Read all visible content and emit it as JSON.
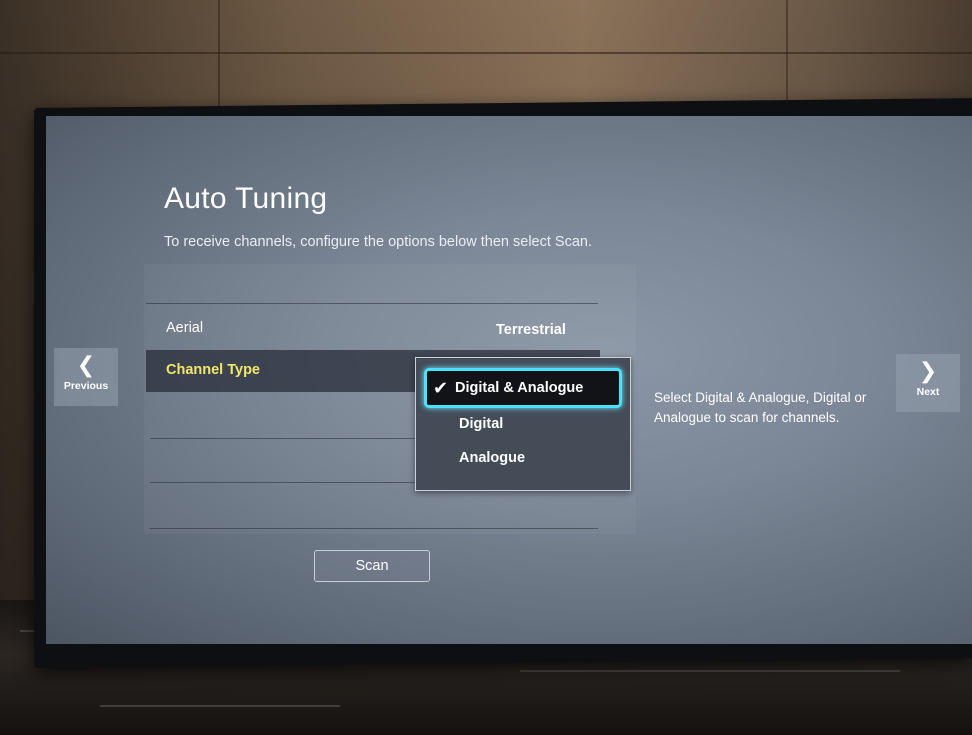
{
  "screen": {
    "title": "Auto Tuning",
    "subtitle": "To receive channels, configure the options below then select Scan."
  },
  "settings": {
    "rows": [
      {
        "label": "Aerial",
        "value": "Terrestrial"
      },
      {
        "label": "Channel Type"
      }
    ]
  },
  "dropdown": {
    "options": [
      "Digital & Analogue",
      "Digital",
      "Analogue"
    ],
    "selected": "Digital & Analogue",
    "check_icon": "checkmark-icon"
  },
  "help_text": "Select Digital & Analogue, Digital or Analogue to scan for channels.",
  "navigation": {
    "previous_label": "Previous",
    "next_label": "Next",
    "previous_icon": "chevron-left-icon",
    "next_icon": "chevron-right-icon"
  },
  "scan_button": "Scan",
  "colors": {
    "highlight_text": "#f2e66a",
    "focus_ring": "#48e1ff",
    "screen_bg": "#7b8796"
  }
}
